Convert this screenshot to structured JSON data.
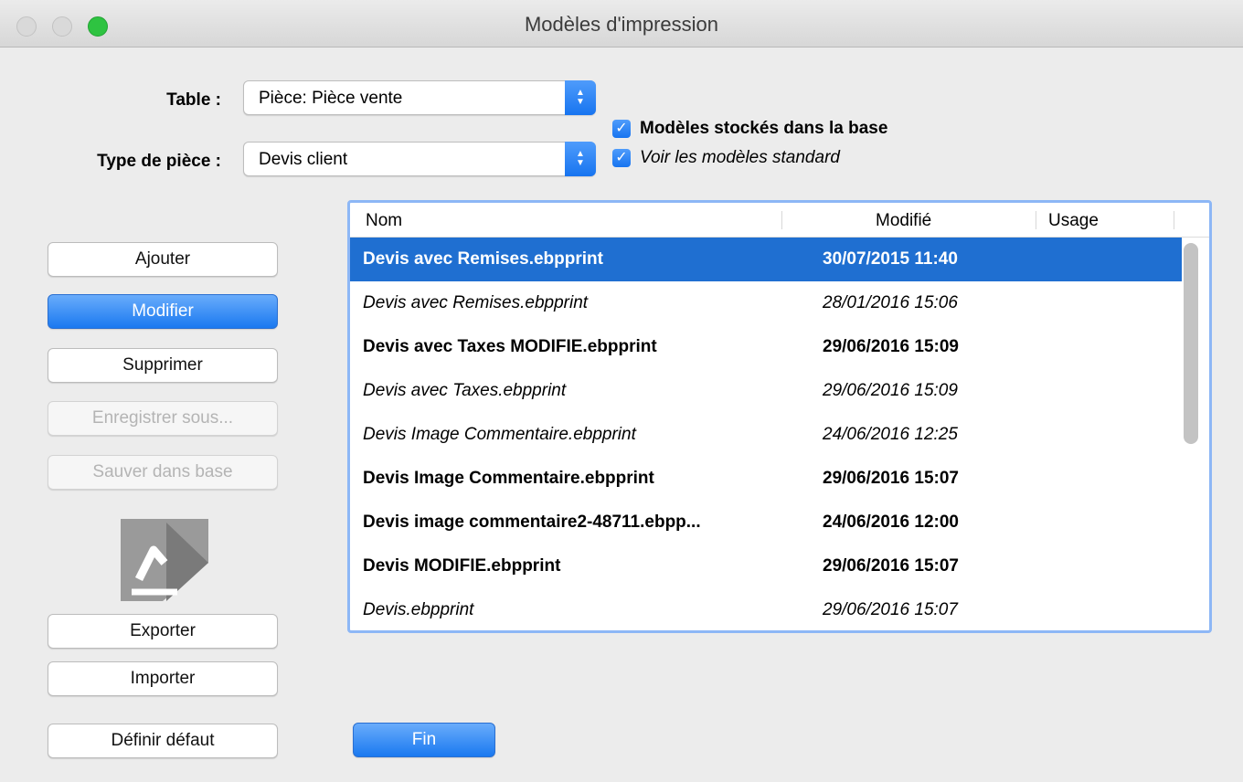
{
  "window": {
    "title": "Modèles d'impression"
  },
  "form": {
    "table_label": "Table :",
    "table_value": "Pièce: Pièce vente",
    "type_label": "Type de pièce :",
    "type_value": "Devis client"
  },
  "options": {
    "stored_in_base": {
      "label": "Modèles stockés dans la base",
      "checked": true
    },
    "show_standard": {
      "label": "Voir les modèles standard",
      "checked": true
    }
  },
  "buttons": {
    "add": "Ajouter",
    "modify": "Modifier",
    "delete": "Supprimer",
    "save_as": "Enregistrer sous...",
    "save_to_base": "Sauver dans base",
    "export": "Exporter",
    "import": "Importer",
    "set_default": "Définir défaut",
    "finish": "Fin"
  },
  "list": {
    "columns": [
      "Nom",
      "Modifié",
      "Usage"
    ],
    "rows": [
      {
        "name": "Devis avec Remises.ebpprint",
        "modified": "30/07/2015 11:40",
        "usage": "",
        "style": "bold",
        "selected": true
      },
      {
        "name": "Devis avec Remises.ebpprint",
        "modified": "28/01/2016 15:06",
        "usage": "",
        "style": "italic",
        "selected": false
      },
      {
        "name": "Devis avec Taxes MODIFIE.ebpprint",
        "modified": "29/06/2016 15:09",
        "usage": "",
        "style": "bold",
        "selected": false
      },
      {
        "name": "Devis avec Taxes.ebpprint",
        "modified": "29/06/2016 15:09",
        "usage": "",
        "style": "italic",
        "selected": false
      },
      {
        "name": "Devis Image Commentaire.ebpprint",
        "modified": "24/06/2016 12:25",
        "usage": "",
        "style": "italic",
        "selected": false
      },
      {
        "name": "Devis Image Commentaire.ebpprint",
        "modified": "29/06/2016 15:07",
        "usage": "",
        "style": "bold",
        "selected": false
      },
      {
        "name": "Devis image commentaire2-48711.ebpp...",
        "modified": "24/06/2016 12:00",
        "usage": "",
        "style": "bold",
        "selected": false
      },
      {
        "name": "Devis MODIFIE.ebpprint",
        "modified": "29/06/2016 15:07",
        "usage": "",
        "style": "bold",
        "selected": false
      },
      {
        "name": "Devis.ebpprint",
        "modified": "29/06/2016 15:07",
        "usage": "",
        "style": "italic",
        "selected": false
      }
    ]
  },
  "icons": {
    "app_logo": "ebp-print-logo-icon",
    "checkbox": "checkmark-icon",
    "popup": "up-down-chevron-icon"
  },
  "colors": {
    "accent": "#1f6fd1",
    "selected_row": "#1f6fd1",
    "zoom_button": "#2ec341"
  }
}
